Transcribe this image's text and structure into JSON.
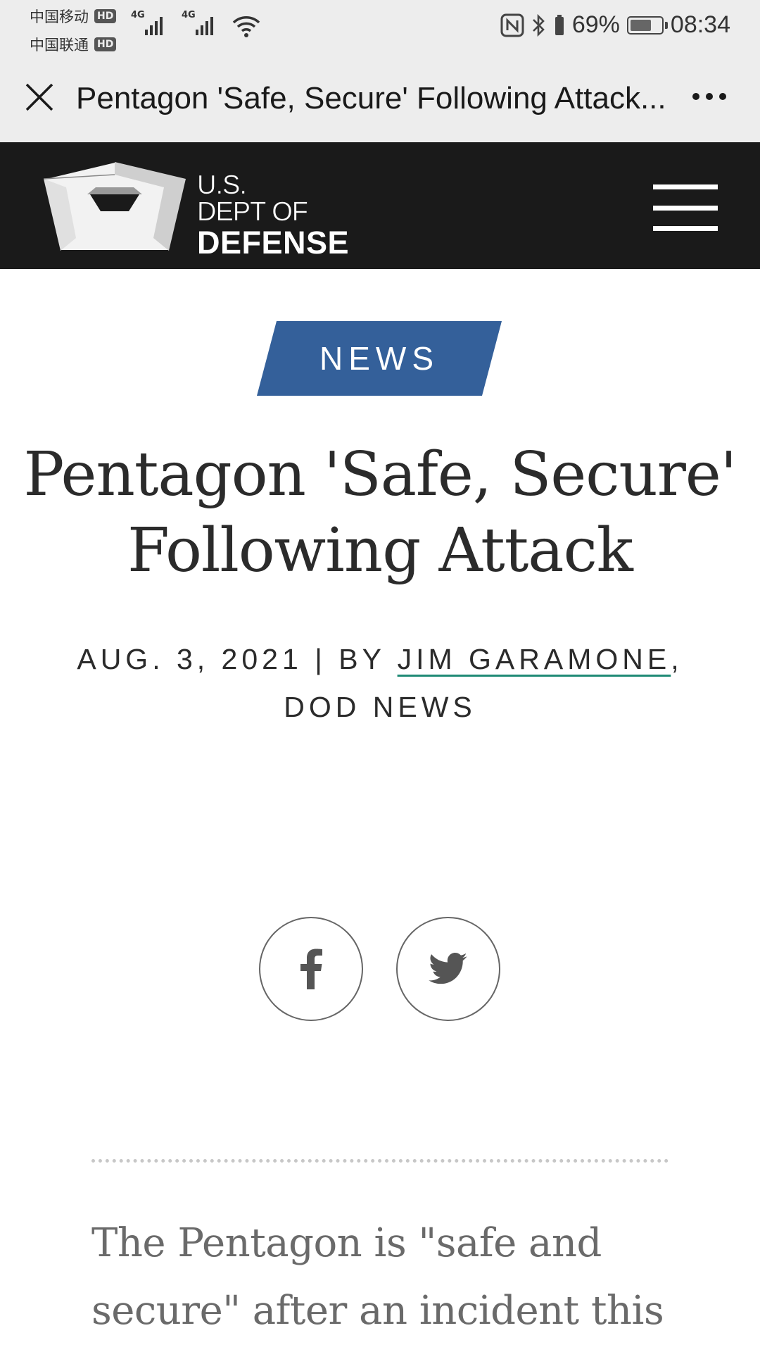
{
  "status_bar": {
    "carrier1": "中国移动",
    "carrier2": "中国联通",
    "hd_badge": "HD",
    "network_tag": "4G",
    "battery_percent": "69%",
    "battery_level": 0.69,
    "time": "08:34"
  },
  "webview": {
    "title": "Pentagon 'Safe, Secure' Following Attack..."
  },
  "site_header": {
    "logo_line1": "U.S.",
    "logo_line2": "DEPT OF",
    "logo_line3": "DEFENSE"
  },
  "article": {
    "category": "NEWS",
    "headline_line1": "Pentagon 'Safe, Secure'",
    "headline_line2": "Following Attack",
    "date": "AUG. 3, 2021",
    "by": "BY",
    "author": "JIM GARAMONE",
    "source": "DOD NEWS",
    "lede_line1": "The Pentagon is \"safe and",
    "lede_line2": "secure\" after an incident this"
  },
  "colors": {
    "status_bar_bg": "#ededed",
    "header_bg": "#1a1a1a",
    "news_badge": "#34609a",
    "author_underline": "#1f8a75"
  },
  "icons": {
    "close": "close-icon",
    "more": "more-dots-icon",
    "menu": "hamburger-menu-icon",
    "facebook": "facebook-icon",
    "twitter": "twitter-icon"
  }
}
